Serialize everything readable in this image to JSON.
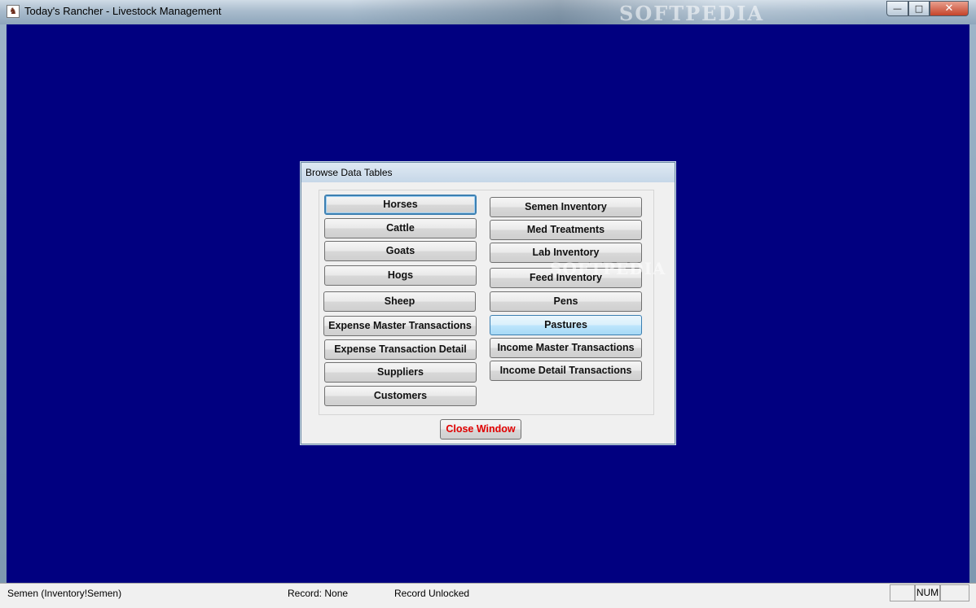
{
  "window": {
    "title": "Today's Rancher - Livestock Management",
    "watermark": "SOFTPEDIA",
    "controls": {
      "minimize": "—",
      "maximize": "□",
      "close": "✕"
    }
  },
  "dialog": {
    "title": "Browse Data Tables",
    "left_buttons": [
      "Horses",
      "Cattle",
      "Goats",
      "Hogs",
      "Sheep",
      "Expense Master Transactions",
      "Expense Transaction Detail",
      "Suppliers",
      "Customers"
    ],
    "right_buttons": [
      "Semen Inventory",
      "Med Treatments",
      "Lab Inventory",
      "Feed Inventory",
      "Pens",
      "Pastures",
      "Income Master Transactions",
      "Income Detail Transactions"
    ],
    "close_label": "Close Window",
    "watermark": "SOFTPEDIA"
  },
  "statusbar": {
    "table": "Semen (Inventory!Semen)",
    "record": "Record: None",
    "lock": "Record Unlocked",
    "num": "NUM"
  },
  "colors": {
    "desktop": "#010080",
    "close_text": "#e00000"
  }
}
